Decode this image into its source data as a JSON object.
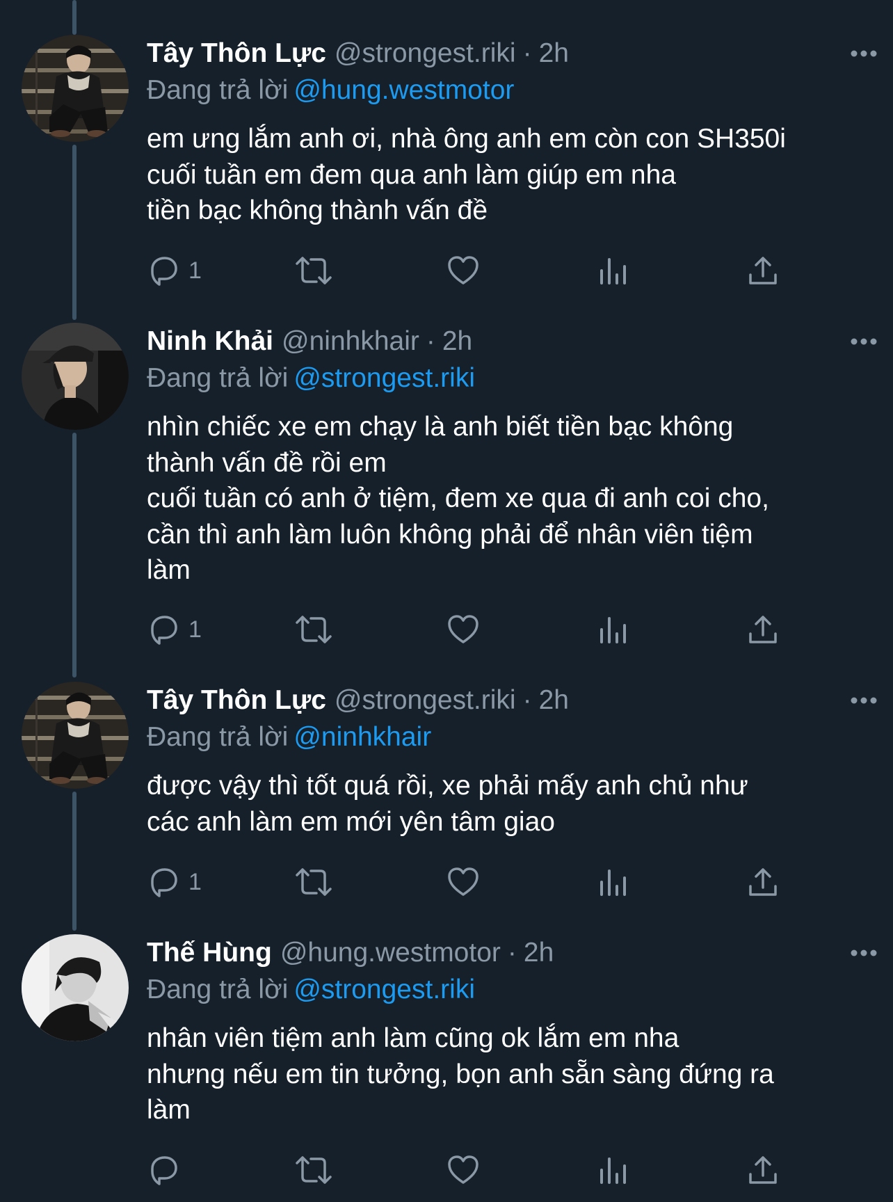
{
  "tweets": [
    {
      "name": "Tây Thôn Lực",
      "handle": "@strongest.riki",
      "dot": "·",
      "time": "2h",
      "reply_prefix": "Đang trả lời",
      "reply_mention": "@hung.westmotor",
      "text": "em ưng lắm anh ơi, nhà ông anh em còn con SH350i\ncuối tuần em đem qua anh làm giúp em nha\ntiền bạc không thành vấn đề",
      "reply_count": "1",
      "avatar": "avatar-riki"
    },
    {
      "name": "Ninh Khải",
      "handle": "@ninhkhair",
      "dot": "·",
      "time": "2h",
      "reply_prefix": "Đang trả lời",
      "reply_mention": "@strongest.riki",
      "text": "nhìn chiếc xe em chạy là anh biết tiền bạc không\nthành vấn đề rồi em\ncuối tuần có anh ở tiệm, đem xe qua đi anh coi cho,\ncần thì anh làm luôn không phải để nhân viên tiệm\nlàm",
      "reply_count": "1",
      "avatar": "avatar-ninhkhai"
    },
    {
      "name": "Tây Thôn Lực",
      "handle": "@strongest.riki",
      "dot": "·",
      "time": "2h",
      "reply_prefix": "Đang trả lời",
      "reply_mention": "@ninhkhair",
      "text": "được vậy thì tốt quá rồi, xe phải mấy anh chủ như\ncác anh làm em mới yên tâm giao",
      "reply_count": "1",
      "avatar": "avatar-riki"
    },
    {
      "name": "Thế Hùng",
      "handle": "@hung.westmotor",
      "dot": "·",
      "time": "2h",
      "reply_prefix": "Đang trả lời",
      "reply_mention": "@strongest.riki",
      "text": "nhân viên tiệm anh làm cũng ok lắm em nha\nnhưng nếu em tin tưởng, bọn anh sẵn sàng đứng ra\nlàm",
      "reply_count": "",
      "avatar": "avatar-hung"
    }
  ],
  "icons": {
    "more": "more-horizontal-icon",
    "reply": "reply-bubble-icon",
    "retweet": "retweet-icon",
    "like": "heart-icon",
    "views": "views-bar-chart-icon",
    "share": "share-upload-icon"
  },
  "colors": {
    "background": "#15202b",
    "text_primary": "#ffffff",
    "text_secondary": "#8b98a5",
    "link": "#1d9bf0",
    "thread_line": "#3d5466"
  }
}
